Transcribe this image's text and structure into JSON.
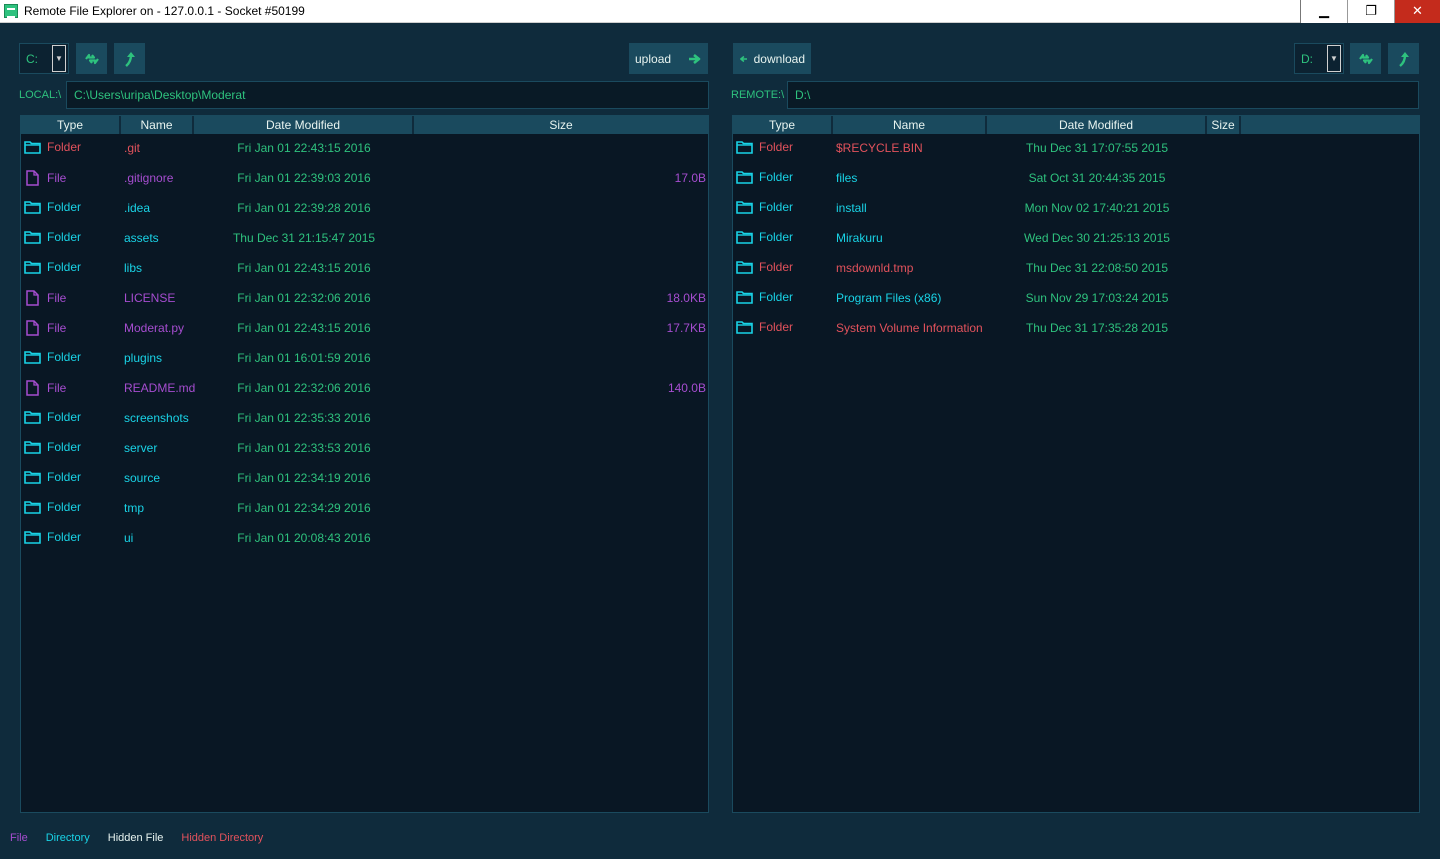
{
  "window": {
    "title": "Remote File Explorer on - 127.0.0.1 - Socket #50199",
    "minimize": "▁",
    "maximize": "❐",
    "close": "✕"
  },
  "colors": {
    "folder": "#19d3e6",
    "hidden": "#e2525c",
    "file": "#a64dd0",
    "date": "#2ec27e"
  },
  "local": {
    "drive": "C:",
    "upload_label": "upload",
    "path_label": "LOCAL:\\",
    "path": "C:\\Users\\uripa\\Desktop\\Moderat",
    "columns": [
      "Type",
      "Name",
      "Date Modified",
      "Size"
    ],
    "rows": [
      {
        "type": "Folder",
        "name": ".git",
        "date": "Fri Jan 01 22:43:15 2016",
        "size": "",
        "kind": "hidden-folder"
      },
      {
        "type": "File",
        "name": ".gitignore",
        "date": "Fri Jan 01 22:39:03 2016",
        "size": "17.0B",
        "kind": "file"
      },
      {
        "type": "Folder",
        "name": ".idea",
        "date": "Fri Jan 01 22:39:28 2016",
        "size": "",
        "kind": "folder"
      },
      {
        "type": "Folder",
        "name": "assets",
        "date": "Thu Dec 31 21:15:47 2015",
        "size": "",
        "kind": "folder"
      },
      {
        "type": "Folder",
        "name": "libs",
        "date": "Fri Jan 01 22:43:15 2016",
        "size": "",
        "kind": "folder"
      },
      {
        "type": "File",
        "name": "LICENSE",
        "date": "Fri Jan 01 22:32:06 2016",
        "size": "18.0KB",
        "kind": "file"
      },
      {
        "type": "File",
        "name": "Moderat.py",
        "date": "Fri Jan 01 22:43:15 2016",
        "size": "17.7KB",
        "kind": "file"
      },
      {
        "type": "Folder",
        "name": "plugins",
        "date": "Fri Jan 01 16:01:59 2016",
        "size": "",
        "kind": "folder"
      },
      {
        "type": "File",
        "name": "README.md",
        "date": "Fri Jan 01 22:32:06 2016",
        "size": "140.0B",
        "kind": "file"
      },
      {
        "type": "Folder",
        "name": "screenshots",
        "date": "Fri Jan 01 22:35:33 2016",
        "size": "",
        "kind": "folder"
      },
      {
        "type": "Folder",
        "name": "server",
        "date": "Fri Jan 01 22:33:53 2016",
        "size": "",
        "kind": "folder"
      },
      {
        "type": "Folder",
        "name": "source",
        "date": "Fri Jan 01 22:34:19 2016",
        "size": "",
        "kind": "folder"
      },
      {
        "type": "Folder",
        "name": "tmp",
        "date": "Fri Jan 01 22:34:29 2016",
        "size": "",
        "kind": "folder"
      },
      {
        "type": "Folder",
        "name": "ui",
        "date": "Fri Jan 01 20:08:43 2016",
        "size": "",
        "kind": "folder"
      }
    ]
  },
  "remote": {
    "drive": "D:",
    "download_label": "download",
    "path_label": "REMOTE:\\",
    "path": "D:\\",
    "columns": [
      "Type",
      "Name",
      "Date Modified",
      "Size"
    ],
    "rows": [
      {
        "type": "Folder",
        "name": "$RECYCLE.BIN",
        "date": "Thu Dec 31 17:07:55 2015",
        "size": "",
        "kind": "hidden-folder"
      },
      {
        "type": "Folder",
        "name": "files",
        "date": "Sat Oct 31 20:44:35 2015",
        "size": "",
        "kind": "folder"
      },
      {
        "type": "Folder",
        "name": "install",
        "date": "Mon Nov 02 17:40:21 2015",
        "size": "",
        "kind": "folder"
      },
      {
        "type": "Folder",
        "name": "Mirakuru",
        "date": "Wed Dec 30 21:25:13 2015",
        "size": "",
        "kind": "folder"
      },
      {
        "type": "Folder",
        "name": "msdownld.tmp",
        "date": "Thu Dec 31 22:08:50 2015",
        "size": "",
        "kind": "hidden-folder"
      },
      {
        "type": "Folder",
        "name": "Program Files (x86)",
        "date": "Sun Nov 29 17:03:24 2015",
        "size": "",
        "kind": "folder"
      },
      {
        "type": "Folder",
        "name": "System Volume Information",
        "date": "Thu Dec 31 17:35:28 2015",
        "size": "",
        "kind": "hidden-folder"
      }
    ]
  },
  "legend": {
    "file": "File",
    "directory": "Directory",
    "hidden_file": "Hidden File",
    "hidden_directory": "Hidden Directory"
  }
}
